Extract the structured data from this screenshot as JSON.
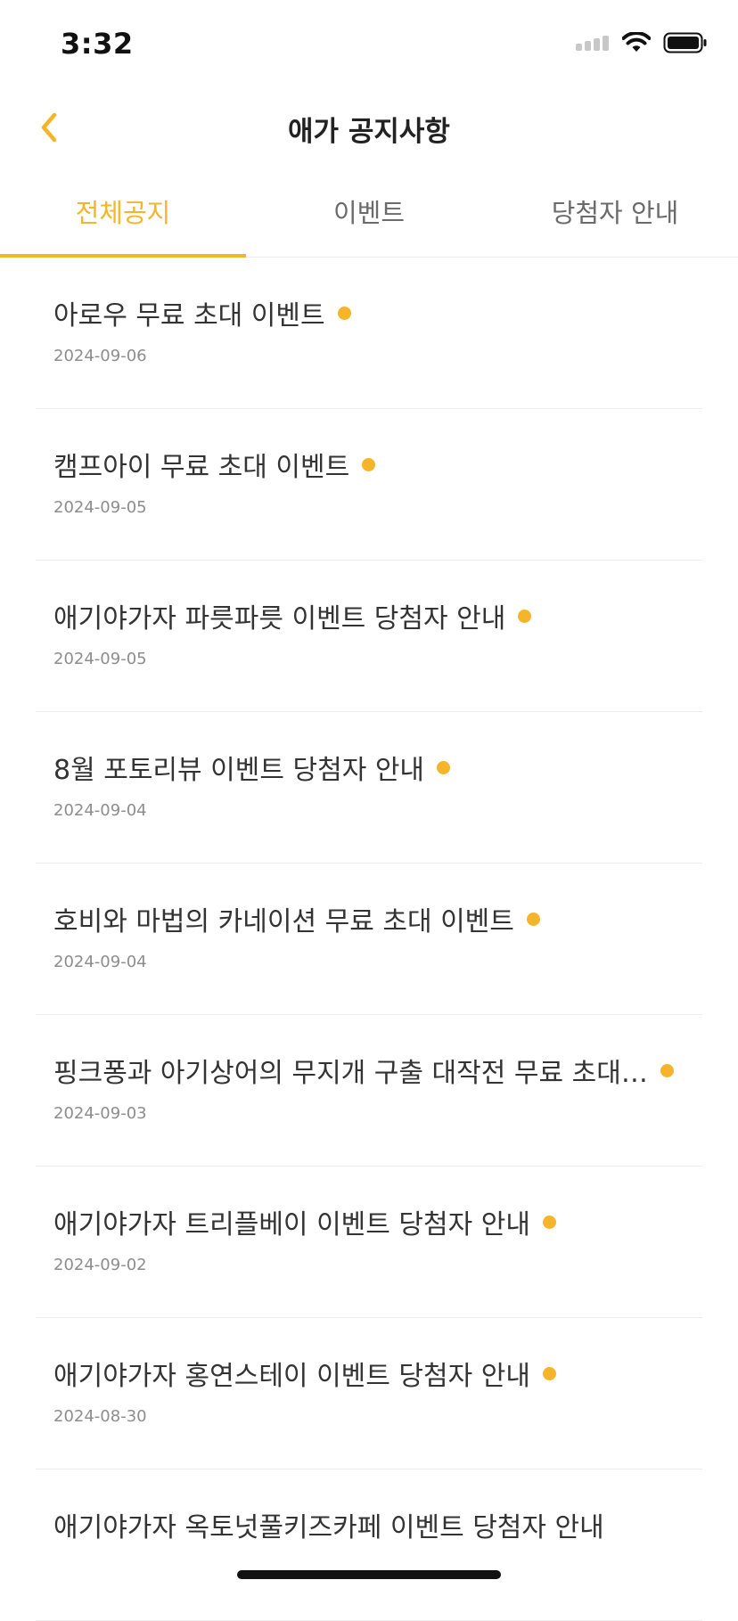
{
  "status_bar": {
    "time": "3:32",
    "icons": [
      "signal-icon",
      "wifi-icon",
      "battery-icon"
    ]
  },
  "header": {
    "back_icon": "chevron-left-icon",
    "title": "애가 공지사항"
  },
  "colors": {
    "accent": "#f5b52a",
    "text": "#333333",
    "muted": "#8d8d8d",
    "divider": "#ededed"
  },
  "tabs": [
    {
      "label": "전체공지",
      "active": true
    },
    {
      "label": "이벤트",
      "active": false
    },
    {
      "label": "당첨자 안내",
      "active": false
    }
  ],
  "notices": [
    {
      "title": "아로우 무료 초대 이벤트",
      "date": "2024-09-06",
      "new": true
    },
    {
      "title": "캠프아이 무료 초대 이벤트",
      "date": "2024-09-05",
      "new": true
    },
    {
      "title": "애기야가자 파릇파릇 이벤트 당첨자 안내",
      "date": "2024-09-05",
      "new": true
    },
    {
      "title": "8월 포토리뷰 이벤트 당첨자 안내",
      "date": "2024-09-04",
      "new": true
    },
    {
      "title": "호비와 마법의 카네이션 무료 초대 이벤트",
      "date": "2024-09-04",
      "new": true
    },
    {
      "title": "핑크퐁과 아기상어의 무지개 구출 대작전 무료 초대…",
      "date": "2024-09-03",
      "new": true
    },
    {
      "title": "애기야가자 트리플베이 이벤트 당첨자 안내",
      "date": "2024-09-02",
      "new": true
    },
    {
      "title": "애기야가자 홍연스테이 이벤트 당첨자 안내",
      "date": "2024-08-30",
      "new": true
    },
    {
      "title": "애기야가자 옥토넛풀키즈카페 이벤트 당첨자 안내",
      "date": "",
      "new": false
    }
  ]
}
